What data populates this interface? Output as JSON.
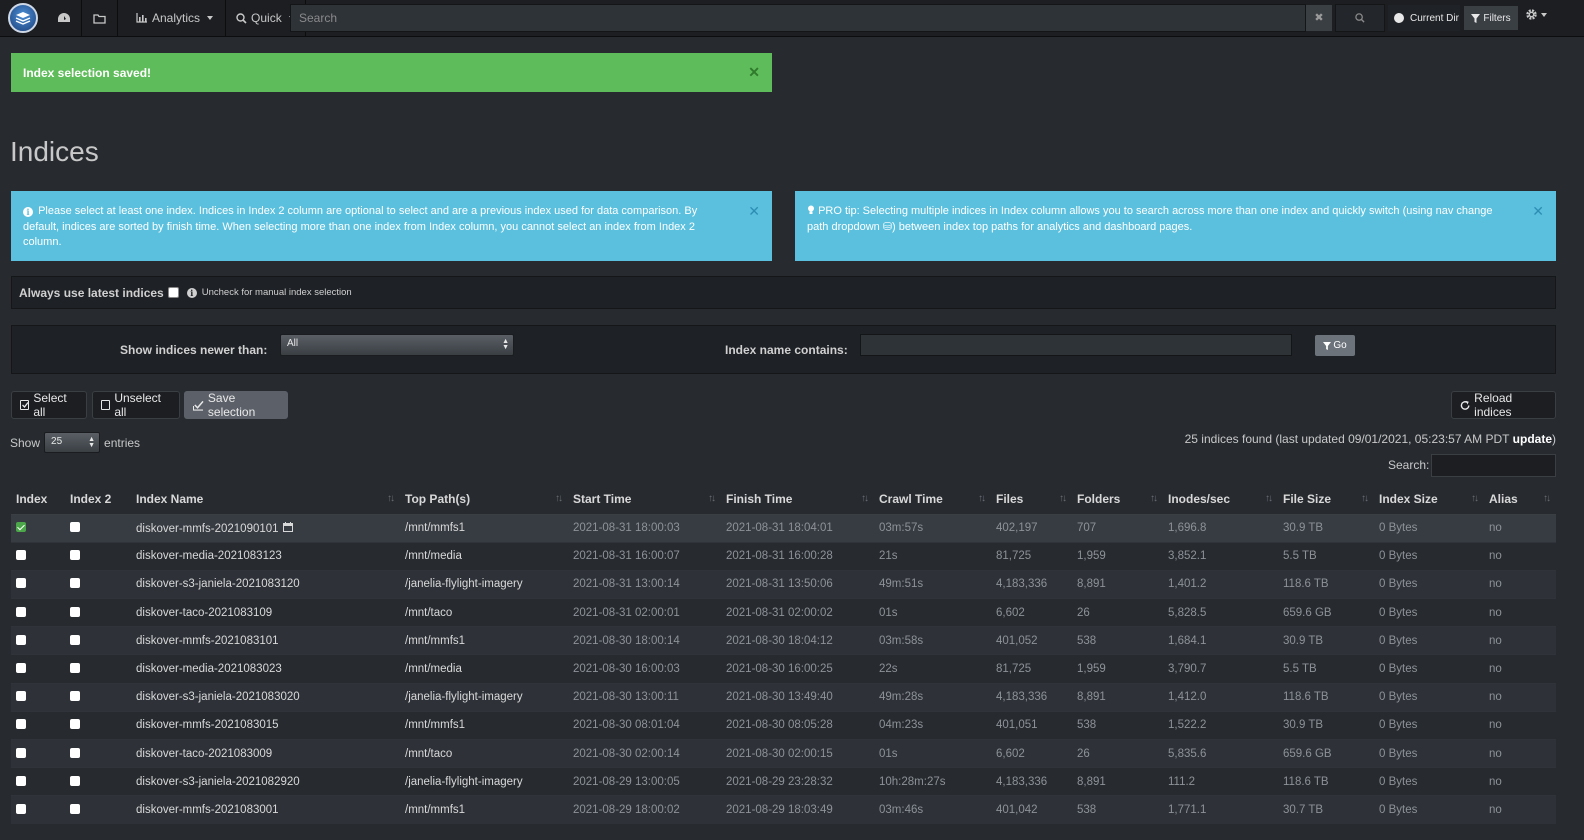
{
  "nav": {
    "analytics": "Analytics",
    "quick": "Quick",
    "search_placeholder": "Search",
    "current_dir": "Current Dir",
    "filters": "Filters"
  },
  "alerts": {
    "success": "Index selection saved!",
    "info": "Please select at least one index. Indices in Index 2 column are optional to select and are a previous index used for data comparison. By default, indices are sorted by finish time. When selecting more than one index from Index column, you cannot select an index from Index 2 column.",
    "tip": "PRO tip: Selecting multiple indices in Index column allows you to search across more than one index and quickly switch (using nav change path dropdown ⛁) between index top paths for analytics and dashboard pages."
  },
  "page_title": "Indices",
  "latest": {
    "label": "Always use latest indices",
    "hint": "Uncheck for manual index selection"
  },
  "filter": {
    "newer_label": "Show indices newer than:",
    "newer_value": "All",
    "name_label": "Index name contains:",
    "go": "Go"
  },
  "buttons": {
    "select_all": "Select all",
    "unselect_all": "Unselect all",
    "save_selection": "Save selection",
    "reload": "Reload indices"
  },
  "table_controls": {
    "show": "Show",
    "entries_value": "25",
    "entries": "entries",
    "found": "25 indices found (last updated 09/01/2021, 05:23:57 AM PDT",
    "update": "update",
    "found_close": ")",
    "search": "Search:"
  },
  "table": {
    "headers": [
      "Index",
      "Index 2",
      "Index Name",
      "Top Path(s)",
      "Start Time",
      "Finish Time",
      "Crawl Time",
      "Files",
      "Folders",
      "Inodes/sec",
      "File Size",
      "Index Size",
      "Alias"
    ],
    "rows": [
      {
        "checked": true,
        "name": "diskover-mmfs-2021090101",
        "path": "/mnt/mmfs1",
        "start": "2021-08-31 18:00:03",
        "finish": "2021-08-31 18:04:01",
        "crawl": "03m:57s",
        "files": "402,197",
        "folders": "707",
        "inodes": "1,696.8",
        "fsize": "30.9 TB",
        "isize": "0 Bytes",
        "alias": "no"
      },
      {
        "checked": false,
        "name": "diskover-media-2021083123",
        "path": "/mnt/media",
        "start": "2021-08-31 16:00:07",
        "finish": "2021-08-31 16:00:28",
        "crawl": "21s",
        "files": "81,725",
        "folders": "1,959",
        "inodes": "3,852.1",
        "fsize": "5.5 TB",
        "isize": "0 Bytes",
        "alias": "no"
      },
      {
        "checked": false,
        "name": "diskover-s3-janiela-2021083120",
        "path": "/janelia-flylight-imagery",
        "start": "2021-08-31 13:00:14",
        "finish": "2021-08-31 13:50:06",
        "crawl": "49m:51s",
        "files": "4,183,336",
        "folders": "8,891",
        "inodes": "1,401.2",
        "fsize": "118.6 TB",
        "isize": "0 Bytes",
        "alias": "no"
      },
      {
        "checked": false,
        "name": "diskover-taco-2021083109",
        "path": "/mnt/taco",
        "start": "2021-08-31 02:00:01",
        "finish": "2021-08-31 02:00:02",
        "crawl": "01s",
        "files": "6,602",
        "folders": "26",
        "inodes": "5,828.5",
        "fsize": "659.6 GB",
        "isize": "0 Bytes",
        "alias": "no"
      },
      {
        "checked": false,
        "name": "diskover-mmfs-2021083101",
        "path": "/mnt/mmfs1",
        "start": "2021-08-30 18:00:14",
        "finish": "2021-08-30 18:04:12",
        "crawl": "03m:58s",
        "files": "401,052",
        "folders": "538",
        "inodes": "1,684.1",
        "fsize": "30.9 TB",
        "isize": "0 Bytes",
        "alias": "no"
      },
      {
        "checked": false,
        "name": "diskover-media-2021083023",
        "path": "/mnt/media",
        "start": "2021-08-30 16:00:03",
        "finish": "2021-08-30 16:00:25",
        "crawl": "22s",
        "files": "81,725",
        "folders": "1,959",
        "inodes": "3,790.7",
        "fsize": "5.5 TB",
        "isize": "0 Bytes",
        "alias": "no"
      },
      {
        "checked": false,
        "name": "diskover-s3-janiela-2021083020",
        "path": "/janelia-flylight-imagery",
        "start": "2021-08-30 13:00:11",
        "finish": "2021-08-30 13:49:40",
        "crawl": "49m:28s",
        "files": "4,183,336",
        "folders": "8,891",
        "inodes": "1,412.0",
        "fsize": "118.6 TB",
        "isize": "0 Bytes",
        "alias": "no"
      },
      {
        "checked": false,
        "name": "diskover-mmfs-2021083015",
        "path": "/mnt/mmfs1",
        "start": "2021-08-30 08:01:04",
        "finish": "2021-08-30 08:05:28",
        "crawl": "04m:23s",
        "files": "401,051",
        "folders": "538",
        "inodes": "1,522.2",
        "fsize": "30.9 TB",
        "isize": "0 Bytes",
        "alias": "no"
      },
      {
        "checked": false,
        "name": "diskover-taco-2021083009",
        "path": "/mnt/taco",
        "start": "2021-08-30 02:00:14",
        "finish": "2021-08-30 02:00:15",
        "crawl": "01s",
        "files": "6,602",
        "folders": "26",
        "inodes": "5,835.6",
        "fsize": "659.6 GB",
        "isize": "0 Bytes",
        "alias": "no"
      },
      {
        "checked": false,
        "name": "diskover-s3-janiela-2021082920",
        "path": "/janelia-flylight-imagery",
        "start": "2021-08-29 13:00:05",
        "finish": "2021-08-29 23:28:32",
        "crawl": "10h:28m:27s",
        "files": "4,183,336",
        "folders": "8,891",
        "inodes": "111.2",
        "fsize": "118.6 TB",
        "isize": "0 Bytes",
        "alias": "no"
      },
      {
        "checked": false,
        "name": "diskover-mmfs-2021083001",
        "path": "/mnt/mmfs1",
        "start": "2021-08-29 18:00:02",
        "finish": "2021-08-29 18:03:49",
        "crawl": "03m:46s",
        "files": "401,042",
        "folders": "538",
        "inodes": "1,771.1",
        "fsize": "30.7 TB",
        "isize": "0 Bytes",
        "alias": "no"
      }
    ]
  },
  "colors": {
    "background": "#272b30",
    "navbar": "#1c1e22",
    "success": "#5fbc5b",
    "info": "#5bc0de"
  }
}
